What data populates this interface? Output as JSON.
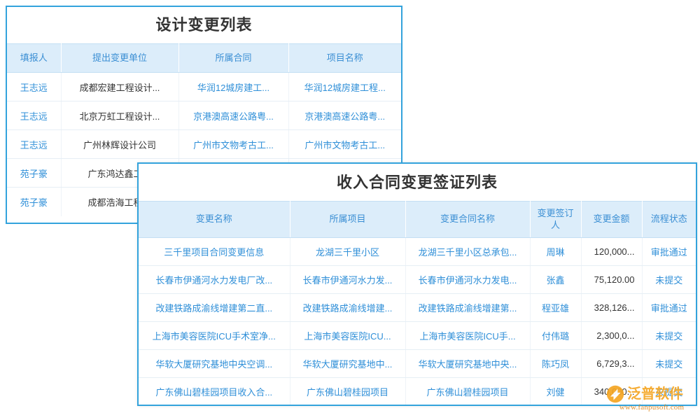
{
  "design_panel": {
    "title": "设计变更列表",
    "columns": [
      "填报人",
      "提出变更单位",
      "所属合同",
      "项目名称"
    ],
    "rows": [
      [
        "王志远",
        "成都宏建工程设计...",
        "华润12城房建工...",
        "华润12城房建工程..."
      ],
      [
        "王志远",
        "北京万虹工程设计...",
        "京港澳高速公路粤...",
        "京港澳高速公路粤..."
      ],
      [
        "王志远",
        "广州林辉设计公司",
        "广州市文物考古工...",
        "广州市文物考古工..."
      ],
      [
        "苑子豪",
        "广东鸿达鑫工程",
        "",
        ""
      ],
      [
        "苑子豪",
        "成都浩海工程设",
        "",
        ""
      ]
    ]
  },
  "income_panel": {
    "title": "收入合同变更签证列表",
    "columns": [
      "变更名称",
      "所属项目",
      "变更合同名称",
      "变更签订人",
      "变更金额",
      "流程状态"
    ],
    "rows": [
      {
        "name": "三千里项目合同变更信息",
        "project": "龙湖三千里小区",
        "contract": "龙湖三千里小区总承包...",
        "signer": "周琳",
        "amount": "120,000...",
        "status": "审批通过",
        "status_kind": "approved"
      },
      {
        "name": "长春市伊通河水力发电厂改...",
        "project": "长春市伊通河水力发...",
        "contract": "长春市伊通河水力发电...",
        "signer": "张鑫",
        "amount": "75,120.00",
        "status": "未提交",
        "status_kind": "draft"
      },
      {
        "name": "改建铁路成渝线增建第二直...",
        "project": "改建铁路成渝线增建...",
        "contract": "改建铁路成渝线增建第...",
        "signer": "程亚雄",
        "amount": "328,126...",
        "status": "审批通过",
        "status_kind": "approved"
      },
      {
        "name": "上海市美容医院ICU手术室净...",
        "project": "上海市美容医院ICU...",
        "contract": "上海市美容医院ICU手...",
        "signer": "付伟璐",
        "amount": "2,300,0...",
        "status": "未提交",
        "status_kind": "draft"
      },
      {
        "name": "华软大厦研究基地中央空调...",
        "project": "华软大厦研究基地中...",
        "contract": "华软大厦研究基地中央...",
        "signer": "陈巧凤",
        "amount": "6,729,3...",
        "status": "未提交",
        "status_kind": "draft"
      },
      {
        "name": "广东佛山碧桂园项目收入合...",
        "project": "广东佛山碧桂园项目",
        "contract": "广东佛山碧桂园项目",
        "signer": "刘健",
        "amount": "340,000...",
        "status": "未提交",
        "status_kind": "draft"
      }
    ]
  },
  "watermark": {
    "brand": "泛普软件",
    "url": "www.fanpusoft.com"
  },
  "colors": {
    "panel_border": "#33a3dc",
    "header_bg": "#dcedfa",
    "header_text": "#3b8fd4",
    "link_text": "#2f8fd8",
    "status_approved": "#2ea82e",
    "status_draft": "#4a4ad8",
    "watermark": "#f5a623"
  }
}
